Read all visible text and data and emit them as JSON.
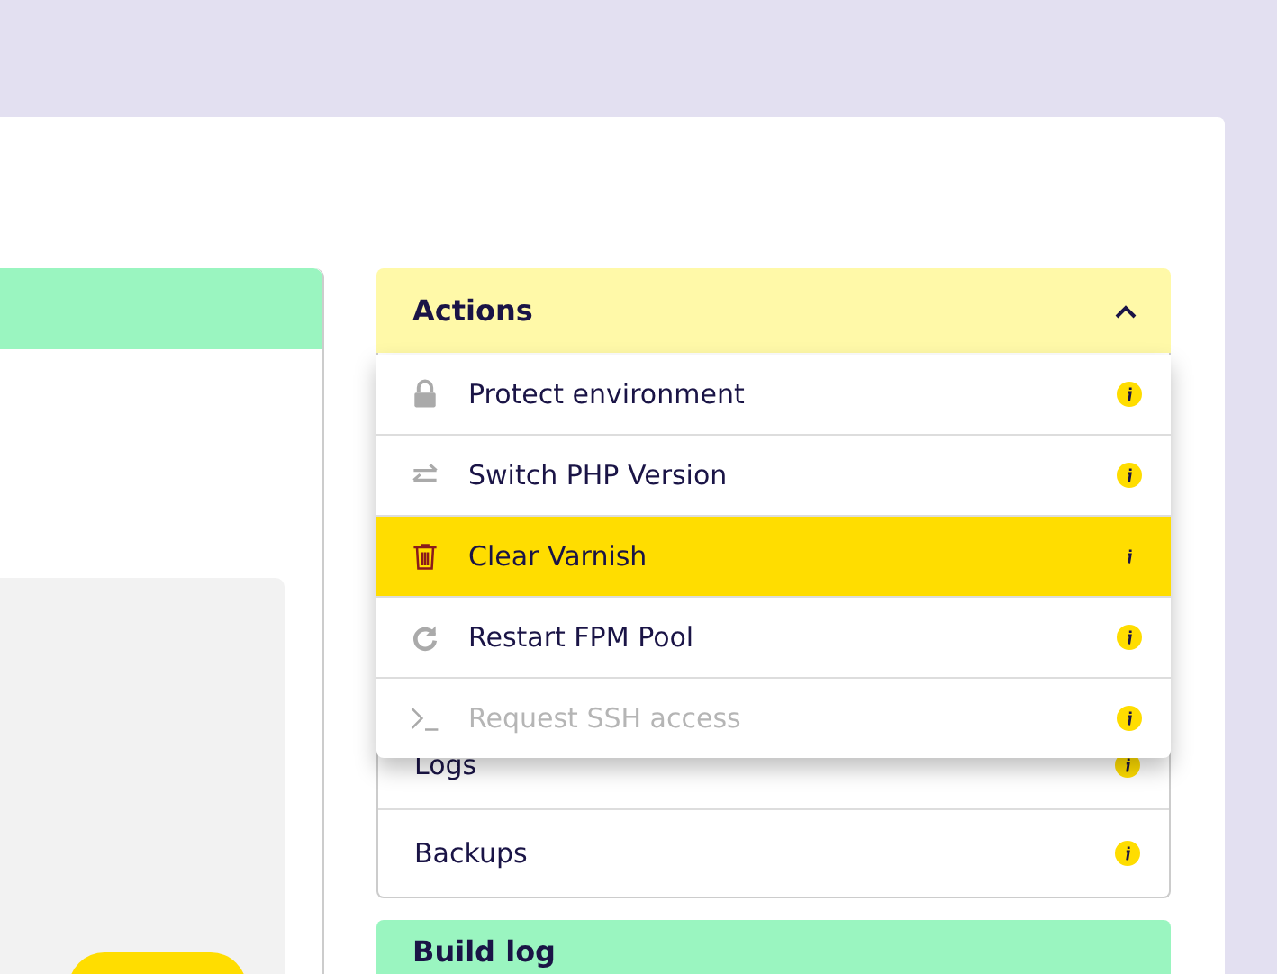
{
  "actions": {
    "title": "Actions",
    "expanded": true,
    "menu": [
      {
        "label": "Protect environment",
        "kind": "lock",
        "selected": false,
        "disabled": false
      },
      {
        "label": "Switch PHP Version",
        "kind": "switch",
        "selected": false,
        "disabled": false
      },
      {
        "label": "Clear Varnish",
        "kind": "trash",
        "selected": true,
        "disabled": false
      },
      {
        "label": "Restart FPM Pool",
        "kind": "restart",
        "selected": false,
        "disabled": false
      },
      {
        "label": "Request SSH access",
        "kind": "terminal",
        "selected": false,
        "disabled": true
      }
    ]
  },
  "links": [
    {
      "label": "Logs"
    },
    {
      "label": "Backups"
    }
  ],
  "build_log": {
    "title": "Build log"
  }
}
